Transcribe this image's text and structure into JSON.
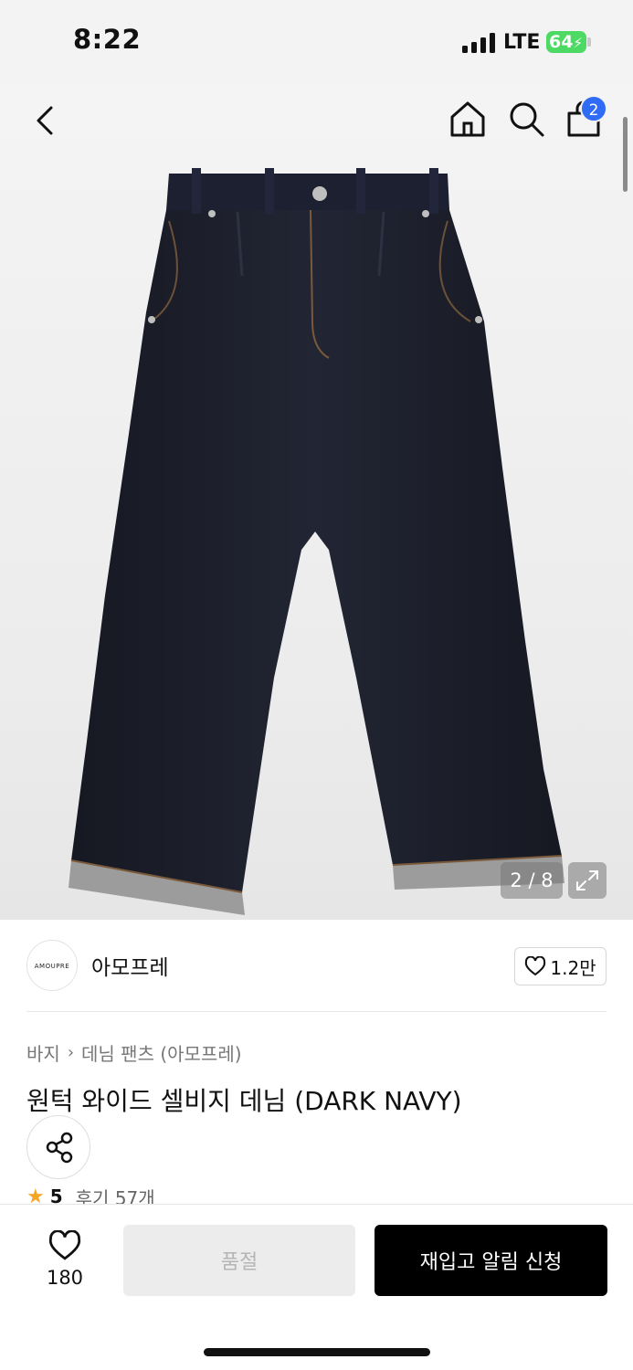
{
  "status_bar": {
    "time": "8:22",
    "network": "LTE",
    "battery": "64"
  },
  "header": {
    "cart_count": "2"
  },
  "gallery": {
    "counter": "2 / 8"
  },
  "brand": {
    "logo_text": "AMOUPRE",
    "name": "아모프레",
    "likes": "1.2만"
  },
  "breadcrumb": {
    "category": "바지",
    "subcategory": "데님 팬츠 (아모프레)"
  },
  "product": {
    "title": "원턱 와이드 셀비지 데님 (DARK NAVY)",
    "rating": "5",
    "reviews": "후기 57개"
  },
  "bottom_bar": {
    "wish_count": "180",
    "soldout_label": "품절",
    "restock_label": "재입고 알림 신청"
  },
  "colors": {
    "accent_blue": "#2f6bf5",
    "battery_green": "#4cd964",
    "denim": "#1c1f2a",
    "star": "#f5a623"
  }
}
